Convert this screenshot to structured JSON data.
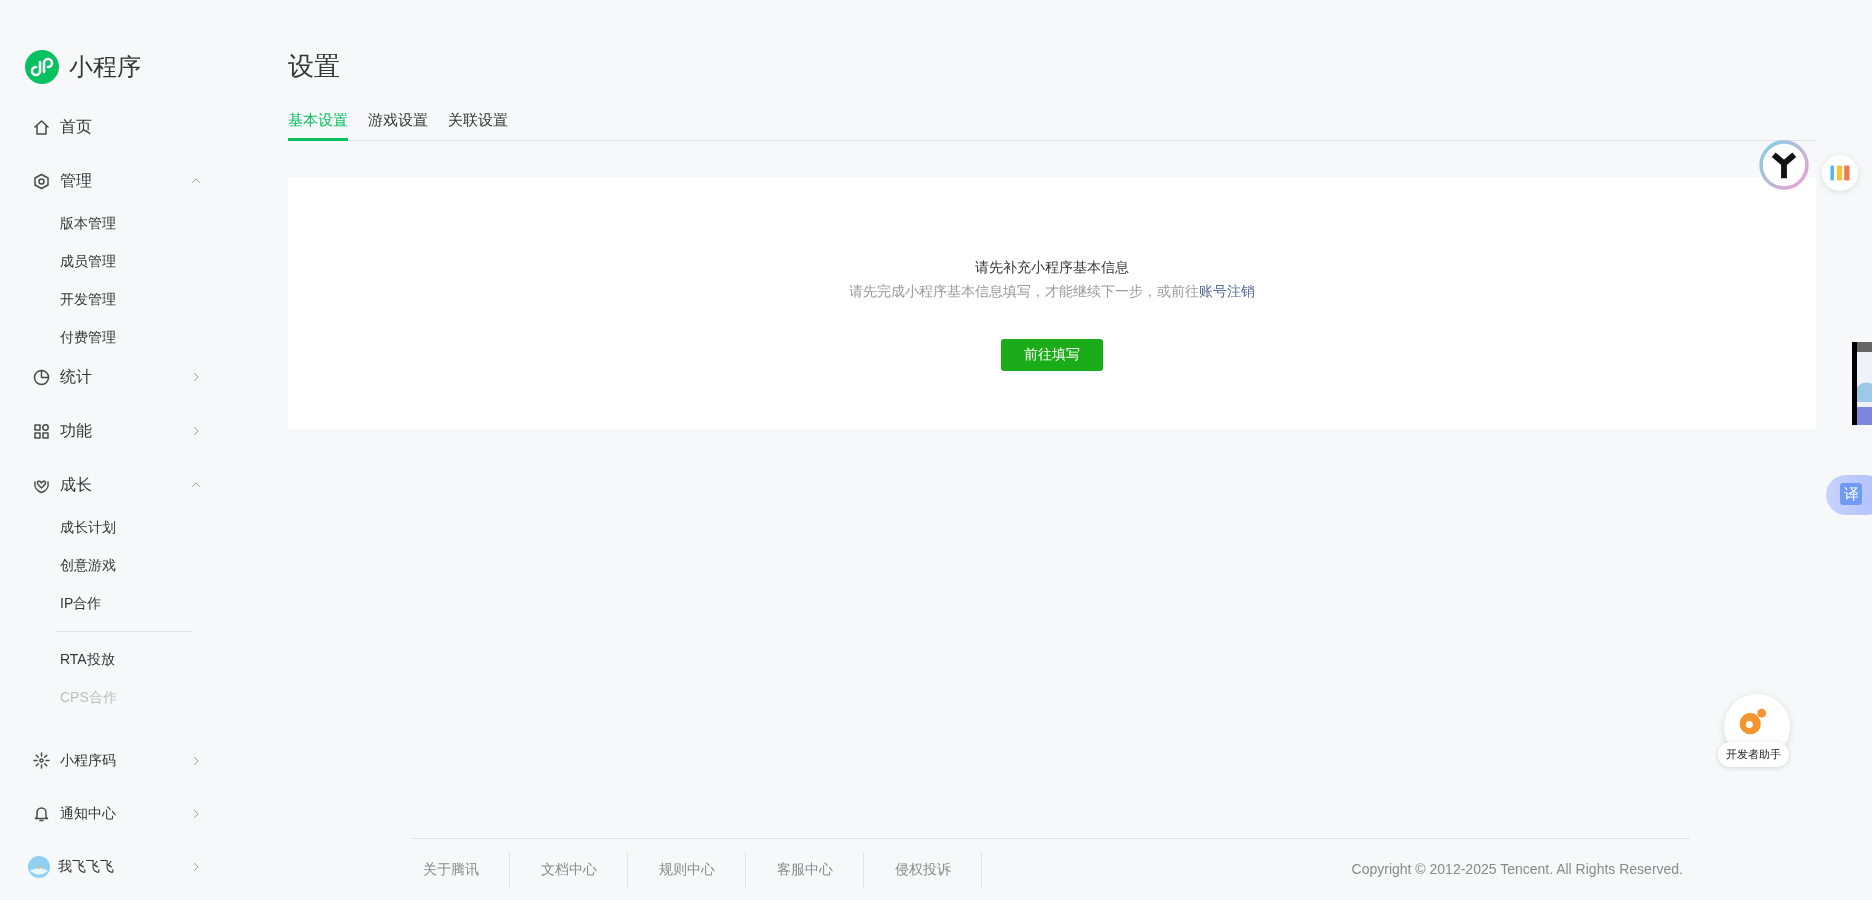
{
  "app": {
    "title": "小程序"
  },
  "sidebar": {
    "items": [
      {
        "label": "首页",
        "kind": "link"
      },
      {
        "label": "管理",
        "kind": "group",
        "expanded": true,
        "children": [
          {
            "kind": "item",
            "label": "版本管理",
            "disabled": false
          },
          {
            "kind": "item",
            "label": "成员管理",
            "disabled": false
          },
          {
            "kind": "item",
            "label": "开发管理",
            "disabled": false
          },
          {
            "kind": "item",
            "label": "付费管理",
            "disabled": false
          }
        ]
      },
      {
        "label": "统计",
        "kind": "group",
        "expanded": false
      },
      {
        "label": "功能",
        "kind": "group",
        "expanded": false
      },
      {
        "label": "成长",
        "kind": "group",
        "expanded": true,
        "children": [
          {
            "kind": "item",
            "label": "成长计划",
            "disabled": false
          },
          {
            "kind": "item",
            "label": "创意游戏",
            "disabled": false
          },
          {
            "kind": "item",
            "label": "IP合作",
            "disabled": false
          },
          {
            "kind": "divider"
          },
          {
            "kind": "item",
            "label": "RTA投放",
            "disabled": false
          },
          {
            "kind": "item",
            "label": "CPS合作",
            "disabled": true
          }
        ]
      }
    ],
    "bottom_items": [
      {
        "label": "小程序码",
        "kind": "link"
      },
      {
        "label": "通知中心",
        "kind": "link"
      },
      {
        "label": "我飞飞飞",
        "kind": "account"
      }
    ]
  },
  "page": {
    "title": "设置",
    "tabs": [
      {
        "label": "基本设置",
        "selected": true
      },
      {
        "label": "游戏设置",
        "selected": false
      },
      {
        "label": "关联设置",
        "selected": false
      }
    ],
    "notice": {
      "heading": "请先补充小程序基本信息",
      "message": "请先完成小程序基本信息填写，才能继续下一步，或前往",
      "link": "账号注销",
      "button": "前往填写"
    }
  },
  "footer": {
    "links": [
      "关于腾讯",
      "文档中心",
      "规则中心",
      "客服中心",
      "侵权投诉"
    ],
    "copyright": "Copyright © 2012-2025 Tencent. All Rights Reserved."
  },
  "floating": {
    "translate": "译",
    "assistant": "开发者助手"
  }
}
